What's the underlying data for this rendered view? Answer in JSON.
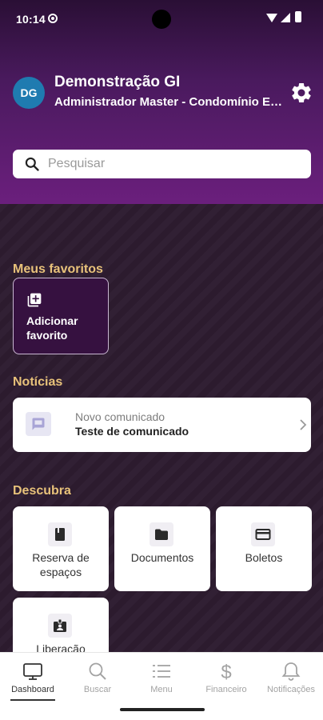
{
  "status_bar": {
    "time": "10:14"
  },
  "header": {
    "avatar_initials": "DG",
    "user_name": "Demonstração GI",
    "user_role": "Administrador Master - Condomínio Exemplo"
  },
  "search": {
    "placeholder": "Pesquisar",
    "value": ""
  },
  "favorites": {
    "title": "Meus favoritos",
    "add_label": "Adicionar favorito"
  },
  "news": {
    "title": "Notícias",
    "items": [
      {
        "kicker": "Novo comunicado",
        "title": "Teste de comunicado"
      }
    ]
  },
  "discover": {
    "title": "Descubra",
    "tiles": [
      {
        "label": "Reserva de espaços",
        "icon": "book-icon"
      },
      {
        "label": "Documentos",
        "icon": "folder-icon"
      },
      {
        "label": "Boletos",
        "icon": "card-icon"
      },
      {
        "label": "Liberação",
        "icon": "id-badge-icon"
      }
    ]
  },
  "bottom_nav": {
    "items": [
      {
        "label": "Dashboard",
        "icon": "monitor-icon",
        "active": true
      },
      {
        "label": "Buscar",
        "icon": "magnifier-icon",
        "active": false
      },
      {
        "label": "Menu",
        "icon": "list-icon",
        "active": false
      },
      {
        "label": "Financeiro",
        "icon": "dollar-icon",
        "active": false
      },
      {
        "label": "Notificações",
        "icon": "bell-icon",
        "active": false
      }
    ]
  },
  "colors": {
    "accent_gold": "#e8c27a",
    "header_purple": "#6b1f7d",
    "avatar_blue": "#1f7bb0",
    "background_dark": "#2d1c30"
  }
}
